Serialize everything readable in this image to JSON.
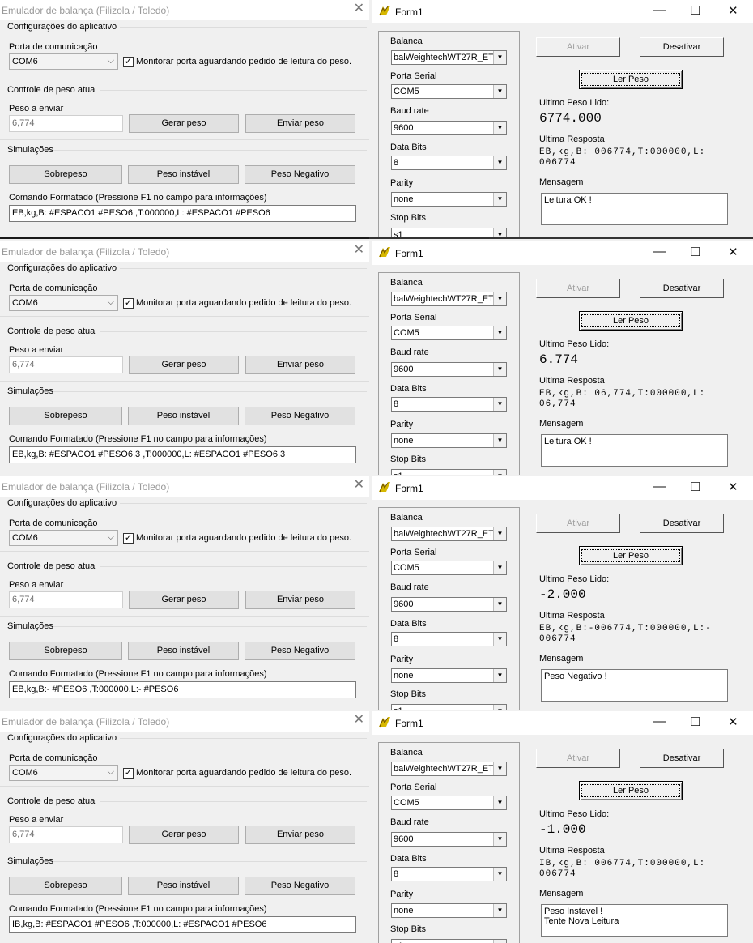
{
  "emulator": {
    "title": "Emulador de balança (Filizola / Toledo)",
    "close_glyph": "✕",
    "group_config": "Configurações do aplicativo",
    "port_label": "Porta de comunicação",
    "port_value": "COM6",
    "monitor_label": "Monitorar porta aguardando pedido de leitura do peso.",
    "monitor_checked": "✓",
    "group_weight": "Controle de peso atual",
    "weight_label": "Peso a enviar",
    "weight_value": "6,774",
    "gen_button": "Gerar peso",
    "send_button": "Enviar peso",
    "group_sim": "Simulações",
    "over_button": "Sobrepeso",
    "unstable_button": "Peso instável",
    "negative_button": "Peso Negativo",
    "cmd_label": "Comando Formatado (Pressione F1 no campo para informações)"
  },
  "form": {
    "title": "Form1",
    "min_glyph": "—",
    "max_glyph": "☐",
    "close_glyph": "✕",
    "balanca_label": "Balanca",
    "balanca_value": "balWeightechWT27R_ETH",
    "porta_label": "Porta Serial",
    "porta_value": "COM5",
    "baud_label": "Baud rate",
    "baud_value": "9600",
    "databits_label": "Data Bits",
    "databits_value": "8",
    "parity_label": "Parity",
    "parity_value": "none",
    "stopbits_label": "Stop Bits",
    "stopbits_value": "s1",
    "ativar_button": "Ativar",
    "desativar_button": "Desativar",
    "lerpeso_button": "Ler Peso",
    "ultimo_label": "Ultimo Peso Lido:",
    "resposta_label": "Ultima Resposta",
    "mensagem_label": "Mensagem",
    "dropdown_glyph": "▼"
  },
  "rows": [
    {
      "emu_command": "EB,kg,B: #ESPACO1 #PESO6 ,T:000000,L: #ESPACO1 #PESO6",
      "ultimo_peso": "6774.000",
      "resposta_l1": "EB,kg,B: 006774,T:000000,L:",
      "resposta_l2": "006774",
      "mensagem_l1": "Leitura OK !",
      "mensagem_l2": ""
    },
    {
      "emu_command": "EB,kg,B: #ESPACO1 #PESO6,3 ,T:000000,L: #ESPACO1 #PESO6,3",
      "ultimo_peso": "6.774",
      "resposta_l1": "EB,kg,B: 06,774,T:000000,L:",
      "resposta_l2": "06,774",
      "mensagem_l1": "Leitura OK !",
      "mensagem_l2": ""
    },
    {
      "emu_command": "EB,kg,B:- #PESO6 ,T:000000,L:- #PESO6",
      "ultimo_peso": "-2.000",
      "resposta_l1": "EB,kg,B:-006774,T:000000,L:-",
      "resposta_l2": "006774",
      "mensagem_l1": "Peso Negativo !",
      "mensagem_l2": ""
    },
    {
      "emu_command": "IB,kg,B: #ESPACO1 #PESO6 ,T:000000,L: #ESPACO1 #PESO6",
      "ultimo_peso": "-1.000",
      "resposta_l1": "IB,kg,B: 006774,T:000000,L:",
      "resposta_l2": "006774",
      "mensagem_l1": "Peso Instavel !",
      "mensagem_l2": "Tente Nova Leitura"
    }
  ]
}
